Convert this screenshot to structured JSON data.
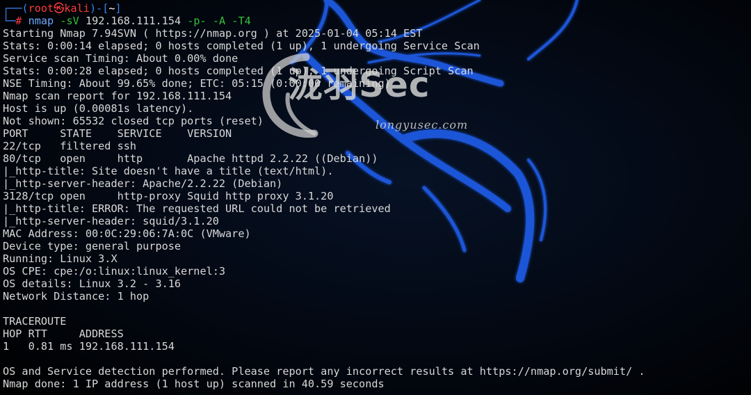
{
  "watermark": {
    "title": "泷羽Sec",
    "url": "longyusec.com"
  },
  "prompt": {
    "corner_top": "┌──",
    "user": "root",
    "skull": "㉿",
    "host": "kali",
    "dir": "~",
    "corner_bottom": "└─",
    "symbol": "#",
    "command": "nmap",
    "arg1": "-sV",
    "target": "192.168.111.154",
    "arg2": "-p-",
    "arg3": "-A",
    "arg4": "-T4"
  },
  "output": [
    "Starting Nmap 7.94SVN ( https://nmap.org ) at 2025-01-04 05:14 EST",
    "Stats: 0:00:14 elapsed; 0 hosts completed (1 up), 1 undergoing Service Scan",
    "Service scan Timing: About 0.00% done",
    "Stats: 0:00:28 elapsed; 0 hosts completed (1 up), 1 undergoing Script Scan",
    "NSE Timing: About 99.65% done; ETC: 05:15 (0:00:00 remaining)",
    "Nmap scan report for 192.168.111.154",
    "Host is up (0.00081s latency).",
    "Not shown: 65532 closed tcp ports (reset)",
    "PORT     STATE    SERVICE    VERSION",
    "22/tcp   filtered ssh",
    "80/tcp   open     http       Apache httpd 2.2.22 ((Debian))",
    "|_http-title: Site doesn't have a title (text/html).",
    "|_http-server-header: Apache/2.2.22 (Debian)",
    "3128/tcp open     http-proxy Squid http proxy 3.1.20",
    "|_http-title: ERROR: The requested URL could not be retrieved",
    "|_http-server-header: squid/3.1.20",
    "MAC Address: 00:0C:29:06:7A:0C (VMware)",
    "Device type: general purpose",
    "Running: Linux 3.X",
    "OS CPE: cpe:/o:linux:linux_kernel:3",
    "OS details: Linux 3.2 - 3.16",
    "Network Distance: 1 hop",
    "",
    "TRACEROUTE",
    "HOP RTT     ADDRESS",
    "1   0.81 ms 192.168.111.154",
    "",
    "OS and Service detection performed. Please report any incorrect results at https://nmap.org/submit/ .",
    "Nmap done: 1 IP address (1 host up) scanned in 40.59 seconds"
  ],
  "colors": {
    "prompt_frame": "#3b82f0",
    "prompt_user": "#ff3b3b",
    "command_args": "#34c13a",
    "text": "#d8d8d8",
    "dragon": "#1f56d8"
  }
}
